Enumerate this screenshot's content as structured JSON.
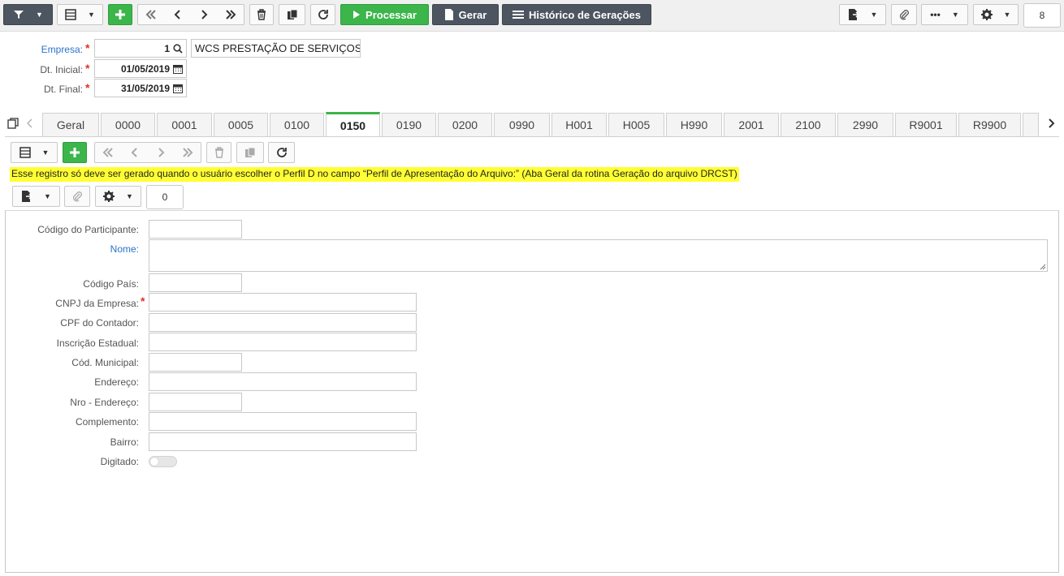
{
  "toolbar": {
    "processar_label": "Processar",
    "gerar_label": "Gerar",
    "historico_label": "Histórico de Gerações",
    "count": "8"
  },
  "header": {
    "empresa_label": "Empresa:",
    "empresa_code": "1",
    "empresa_name": "WCS PRESTAÇÃO DE SERVIÇOS",
    "dt_inicial_label": "Dt. Inicial:",
    "dt_inicial": "01/05/2019",
    "dt_final_label": "Dt. Final:",
    "dt_final": "31/05/2019"
  },
  "tabs": [
    {
      "label": "Geral"
    },
    {
      "label": "0000"
    },
    {
      "label": "0001"
    },
    {
      "label": "0005"
    },
    {
      "label": "0100"
    },
    {
      "label": "0150"
    },
    {
      "label": "0190"
    },
    {
      "label": "0200"
    },
    {
      "label": "0990"
    },
    {
      "label": "H001"
    },
    {
      "label": "H005"
    },
    {
      "label": "H990"
    },
    {
      "label": "2001"
    },
    {
      "label": "2100"
    },
    {
      "label": "2990"
    },
    {
      "label": "R9001"
    },
    {
      "label": "R9900"
    }
  ],
  "active_tab": "0150",
  "notice": "Esse registro só deve ser gerado quando o usuário escolher o Perfil D no campo “Perfil de Apresentação do Arquivo:” (Aba Geral da rotina Geração do arquivo DRCST)",
  "sub_toolbar": {
    "count": "0"
  },
  "form": {
    "fields": [
      {
        "label": "Código do Participante:",
        "value": ""
      },
      {
        "label": "Nome:",
        "value": ""
      },
      {
        "label": "Código País:",
        "value": ""
      },
      {
        "label": "CNPJ da Empresa:",
        "value": ""
      },
      {
        "label": "CPF do Contador:",
        "value": ""
      },
      {
        "label": "Inscrição Estadual:",
        "value": ""
      },
      {
        "label": "Cód. Municipal:",
        "value": ""
      },
      {
        "label": "Endereço:",
        "value": ""
      },
      {
        "label": "Nro - Endereço:",
        "value": ""
      },
      {
        "label": "Complemento:",
        "value": ""
      },
      {
        "label": "Bairro:",
        "value": ""
      },
      {
        "label": "Digitado:",
        "value": ""
      }
    ],
    "digitado_on": false
  },
  "colors": {
    "accent_green": "#3cb54a",
    "dark_button": "#4c5560",
    "link_blue": "#2a73c9",
    "required_red": "#d9342b",
    "notice_yellow": "#ffff33"
  }
}
